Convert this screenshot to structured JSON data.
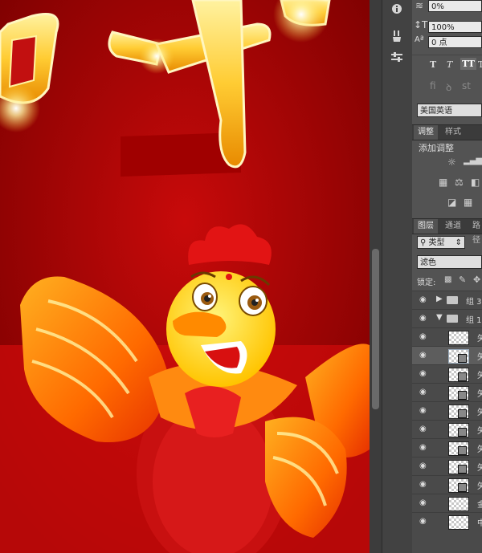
{
  "character_panel": {
    "tracking_value": "0%",
    "vertical_scale_value": "100%",
    "baseline_shift_value": "0 点",
    "language_value": "美国英语",
    "text_styles": [
      "T",
      "T",
      "TT",
      "T"
    ]
  },
  "adjustments_panel": {
    "tabs": [
      "调整",
      "样式"
    ],
    "title": "添加调整"
  },
  "layers_panel": {
    "tabs": [
      "图层",
      "通道",
      "路径"
    ],
    "filter_kind_label": "类型",
    "blend_mode_value": "滤色",
    "lock_label": "锁定:",
    "groups": [
      {
        "name": "组 3",
        "expanded": false
      },
      {
        "name": "组 1",
        "expanded": true
      }
    ],
    "layer_names": [
      "矢",
      "矢",
      "矢",
      "矢",
      "矢",
      "矢",
      "矢",
      "矢",
      "矢",
      "金",
      "中"
    ]
  },
  "colors": {
    "canvas_red": "#c40a0a",
    "panel_bg": "#535353",
    "toolstrip_bg": "#424242",
    "gold": "#ffd23a"
  },
  "icons": [
    "info-icon",
    "brush-icon",
    "sliders-icon",
    "brightness-icon",
    "levels-icon",
    "curves-icon",
    "exposure-icon",
    "eye-icon",
    "folder-icon"
  ]
}
